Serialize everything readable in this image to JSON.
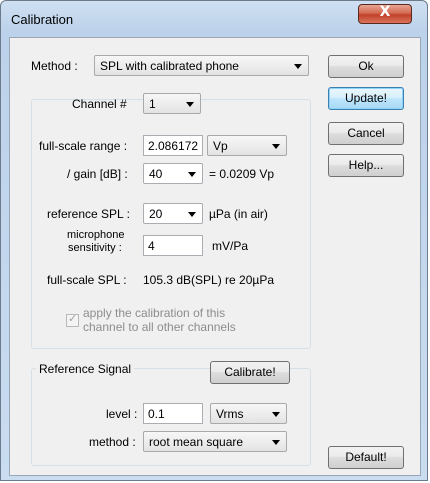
{
  "window": {
    "title": "Calibration",
    "close_glyph": "X"
  },
  "method": {
    "label": "Method :",
    "value": "SPL with calibrated phone"
  },
  "buttons": {
    "ok": "Ok",
    "update": "Update!",
    "cancel": "Cancel",
    "help": "Help...",
    "default": "Default!",
    "calibrate": "Calibrate!"
  },
  "channel": {
    "label": "Channel #",
    "value": "1",
    "fullscale_range_label": "full-scale range :",
    "fullscale_range_value": "2.086172",
    "fullscale_unit": "Vp",
    "gain_label": "/ gain [dB] :",
    "gain_value": "40",
    "gain_result": "= 0.0209 Vp",
    "ref_spl_label": "reference SPL :",
    "ref_spl_value": "20",
    "ref_spl_unit": "µPa  (in air)",
    "mic_label_line1": "microphone",
    "mic_label_line2": "sensitivity :",
    "mic_value": "4",
    "mic_unit": "mV/Pa",
    "fullscale_spl_label": "full-scale SPL :",
    "fullscale_spl_value": "105.3 dB(SPL) re 20µPa",
    "apply_line1": "apply the calibration of this",
    "apply_line2": "channel to all other channels",
    "apply_checked": true
  },
  "reference": {
    "title": "Reference Signal",
    "level_label": "level :",
    "level_value": "0.1",
    "level_unit": "Vrms",
    "method_label": "method :",
    "method_value": "root mean square"
  }
}
